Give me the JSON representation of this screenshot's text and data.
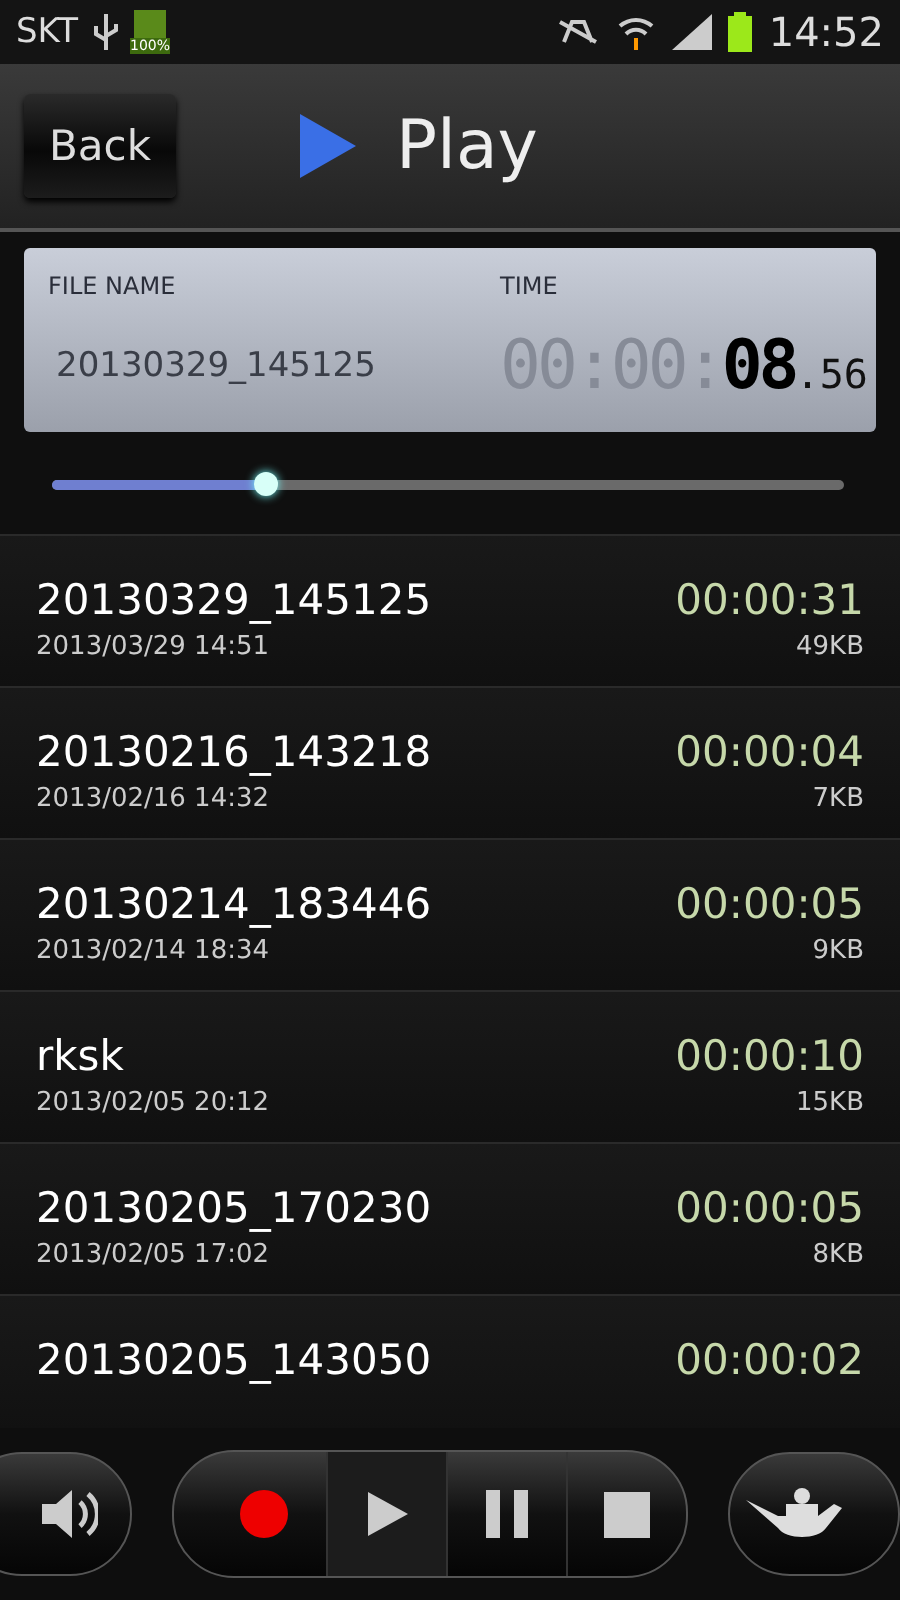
{
  "status_bar": {
    "carrier": "SKT",
    "battery_label": "100%",
    "time": "14:52"
  },
  "header": {
    "back": "Back",
    "title": "Play"
  },
  "now_playing": {
    "file_label": "FILE NAME",
    "time_label": "TIME",
    "file_name": "20130329_145125",
    "time_dim": "00:00:",
    "time_main": "08",
    "time_fraction": ".56"
  },
  "progress": {
    "level": 0.27
  },
  "recordings": [
    {
      "name": "20130329_145125",
      "date": "2013/03/29 14:51",
      "duration": "00:00:31",
      "size": "49KB"
    },
    {
      "name": "20130216_143218",
      "date": "2013/02/16 14:32",
      "duration": "00:00:04",
      "size": "7KB"
    },
    {
      "name": "20130214_183446",
      "date": "2013/02/14 18:34",
      "duration": "00:00:05",
      "size": "9KB"
    },
    {
      "name": "rksk",
      "date": "2013/02/05 20:12",
      "duration": "00:00:10",
      "size": "15KB"
    },
    {
      "name": "20130205_170230",
      "date": "2013/02/05 17:02",
      "duration": "00:00:05",
      "size": "8KB"
    },
    {
      "name": "20130205_143050",
      "duration": "00:00:02"
    }
  ],
  "controls": [
    {
      "kind": "record",
      "selected": false
    },
    {
      "kind": "play",
      "selected": true
    },
    {
      "kind": "pause",
      "selected": false
    },
    {
      "kind": "stop",
      "selected": false
    }
  ]
}
